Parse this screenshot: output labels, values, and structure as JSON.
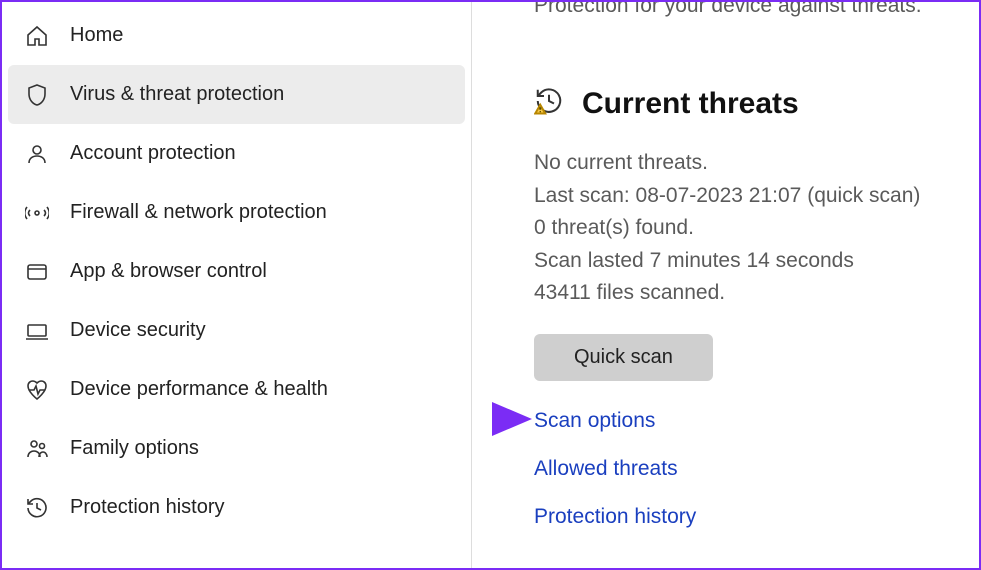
{
  "partial_top": "Protection for your device against threats.",
  "sidebar": {
    "items": [
      {
        "label": "Home"
      },
      {
        "label": "Virus & threat protection"
      },
      {
        "label": "Account protection"
      },
      {
        "label": "Firewall & network protection"
      },
      {
        "label": "App & browser control"
      },
      {
        "label": "Device security"
      },
      {
        "label": "Device performance & health"
      },
      {
        "label": "Family options"
      },
      {
        "label": "Protection history"
      }
    ]
  },
  "main": {
    "section_title": "Current threats",
    "status": {
      "no_threats": "No current threats.",
      "last_scan": "Last scan: 08-07-2023 21:07 (quick scan)",
      "threats_found": "0 threat(s) found.",
      "duration": "Scan lasted 7 minutes 14 seconds",
      "files_scanned": "43411 files scanned."
    },
    "quick_scan_label": "Quick scan",
    "links": {
      "scan_options": "Scan options",
      "allowed_threats": "Allowed threats",
      "protection_history": "Protection history"
    }
  }
}
